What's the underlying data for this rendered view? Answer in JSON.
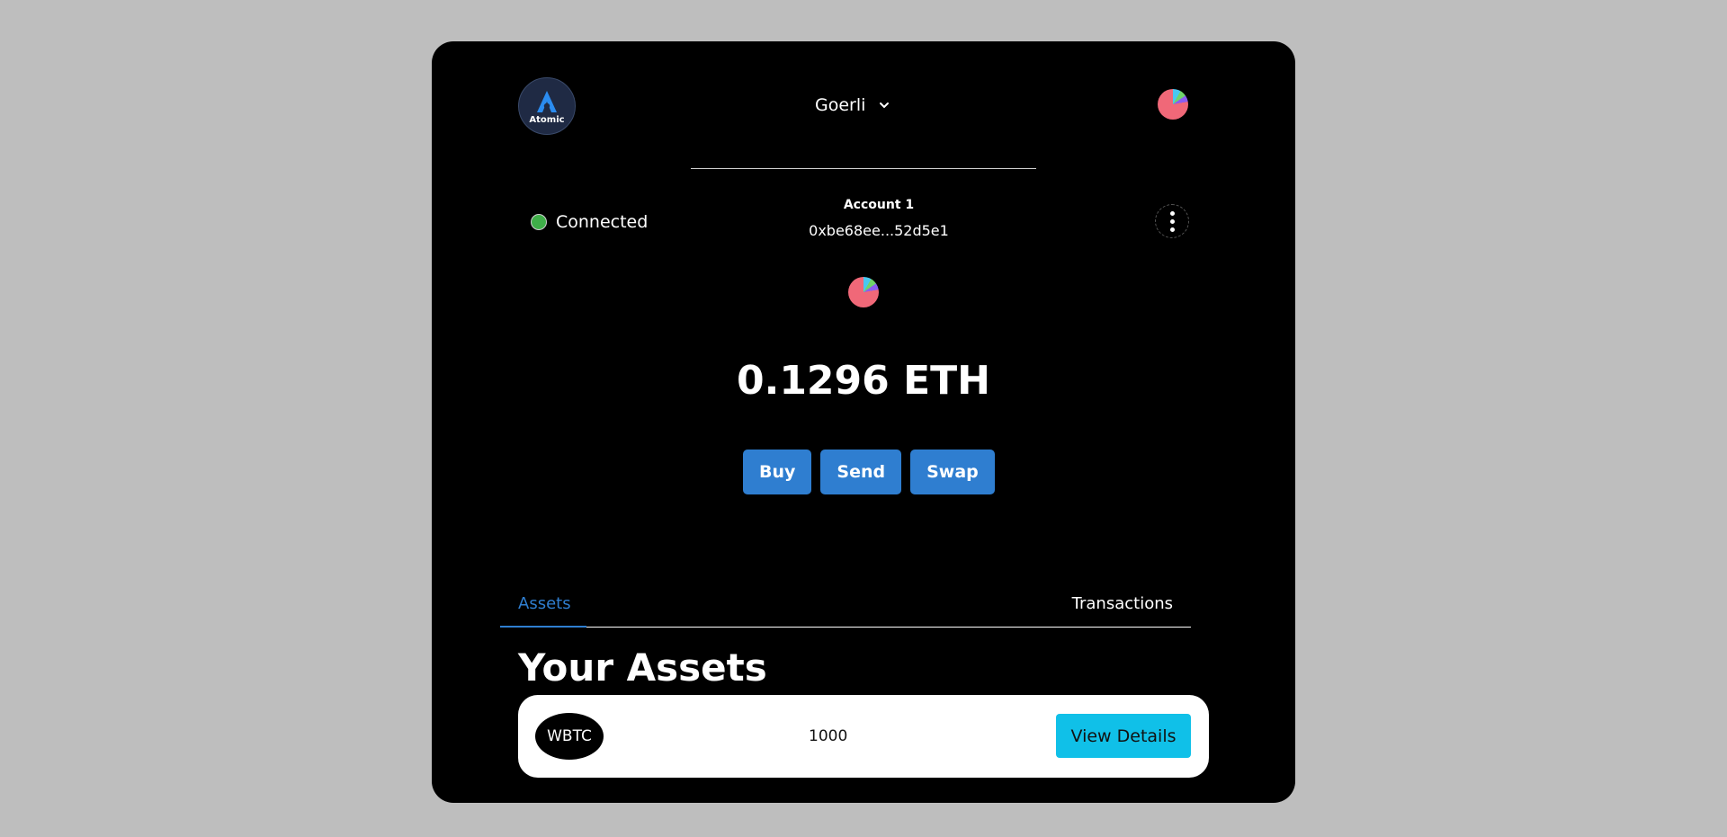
{
  "header": {
    "logo_text": "Atomic",
    "network": "Goerli"
  },
  "account": {
    "status": "Connected",
    "name": "Account 1",
    "address": "0xbe68ee...52d5e1"
  },
  "balance": "0.1296 ETH",
  "actions": {
    "buy": "Buy",
    "send": "Send",
    "swap": "Swap"
  },
  "tabs": {
    "assets": "Assets",
    "transactions": "Transactions"
  },
  "assets_section": {
    "title": "Your Assets",
    "items": [
      {
        "symbol": "WBTC",
        "amount": "1000",
        "action": "View Details"
      }
    ]
  },
  "colors": {
    "accent": "#2f7ed0",
    "details_button": "#10c0e8",
    "connected": "#3fae49"
  },
  "icons": {
    "logo": "atomic-logo-icon",
    "network_dropdown": "chevron-down-icon",
    "menu": "kebab-menu-icon",
    "avatar": "jazzicon-avatar"
  }
}
